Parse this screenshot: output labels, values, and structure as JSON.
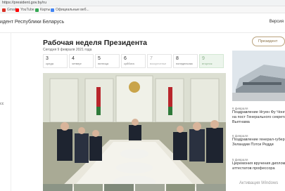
{
  "browser": {
    "url": "https://president.gov.by/ru",
    "bookmarks": [
      {
        "label": "Gmail",
        "icon": "gmail-icon",
        "color": "#d93025"
      },
      {
        "label": "YouTube",
        "icon": "youtube-icon",
        "color": "#ff0000"
      },
      {
        "label": "Карты",
        "icon": "maps-icon",
        "color": "#34a853"
      },
      {
        "label": "Официальные веб...",
        "icon": "web-icon",
        "color": "#4285f4"
      }
    ]
  },
  "site": {
    "title": "идент Республики Беларусь",
    "header_right": "Версия"
  },
  "left": {
    "label": "сс"
  },
  "page": {
    "title": "Рабочая неделя Президента",
    "date": "Сегодня 9 февраля 2021 года",
    "subscribe": "Президент"
  },
  "days": [
    {
      "num": "3",
      "name": "среда",
      "state": "normal"
    },
    {
      "num": "4",
      "name": "четверг",
      "state": "normal"
    },
    {
      "num": "5",
      "name": "пятница",
      "state": "normal"
    },
    {
      "num": "6",
      "name": "суббота",
      "state": "normal"
    },
    {
      "num": "7",
      "name": "воскресенье",
      "state": "muted"
    },
    {
      "num": "8",
      "name": "понедельник",
      "state": "normal"
    },
    {
      "num": "9",
      "name": "вторник",
      "state": "active"
    }
  ],
  "news": [
    {
      "date": "6 февраля",
      "lines": [
        "Поздравление Нгуен Фу Чонгу",
        "на пост Генерального секретаря",
        "Вьетнама"
      ]
    },
    {
      "date": "6 февраля",
      "lines": [
        "Поздравление генерал-губернатору",
        "Зеландии Пэтси Редди"
      ]
    },
    {
      "date": "5 февраля",
      "lines": [
        "Церемония вручения дипломов",
        "аттестатов профессора"
      ]
    }
  ],
  "watermark": "Активация Windows",
  "colors": {
    "accent": "#b9a27d",
    "active_day": "#ecf5ec"
  }
}
